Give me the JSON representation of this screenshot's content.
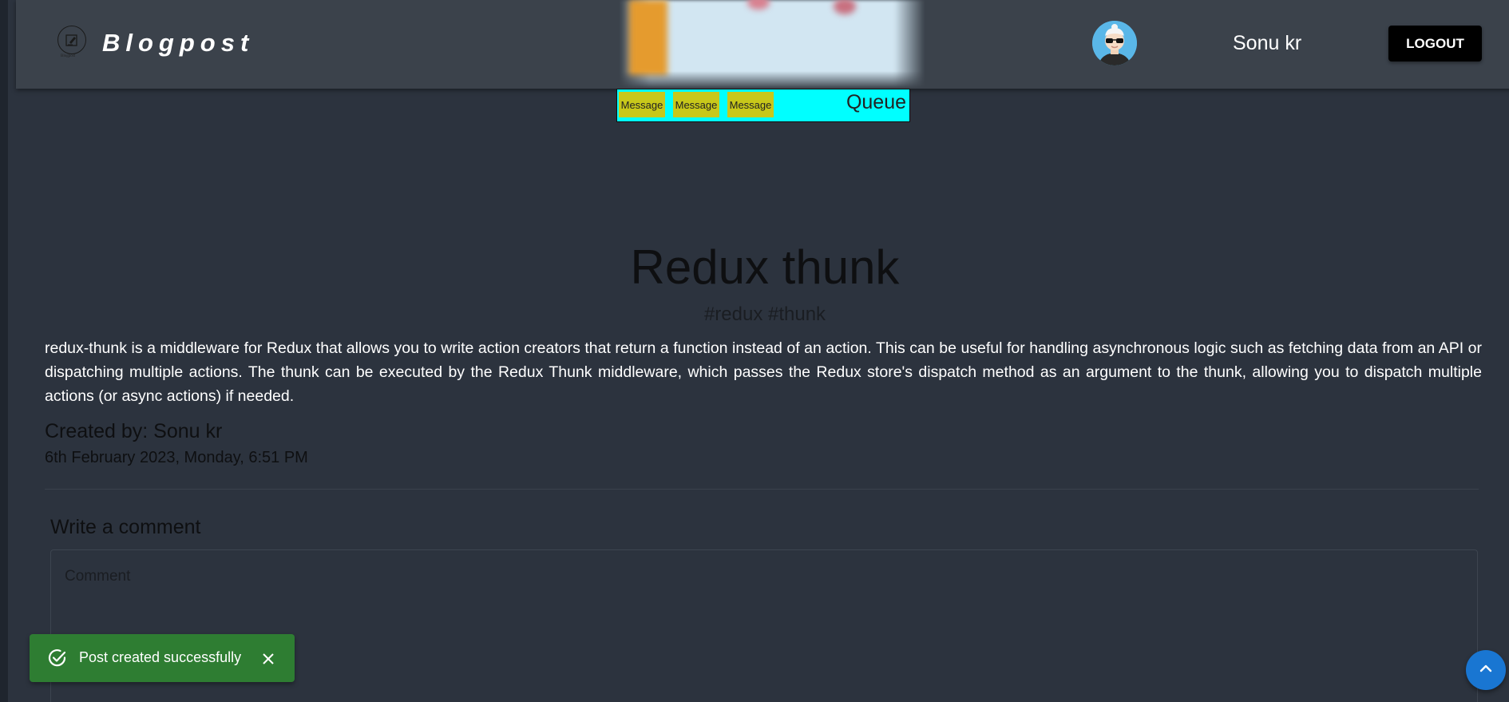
{
  "header": {
    "brand": "Blogpost",
    "logo_subtext": "Blogpost",
    "user_name": "Sonu kr",
    "logout_label": "LOGOUT"
  },
  "queue_banner": {
    "messages": [
      "Message",
      "Message",
      "Message"
    ],
    "label": "Queue"
  },
  "post": {
    "title": "Redux thunk",
    "tags": "#redux #thunk",
    "body": "redux-thunk is a middleware for Redux that allows you to write action creators that return a function instead of an action. This can be useful for handling asynchronous logic such as fetching data from an API or dispatching multiple actions. The thunk can be executed by the Redux Thunk middleware, which passes the Redux store's dispatch method as an argument to the thunk, allowing you to dispatch multiple actions (or async actions) if needed.",
    "created_by": "Created by: Sonu kr",
    "created_date": "6th February 2023, Monday, 6:51 PM"
  },
  "comments": {
    "heading": "Write a comment",
    "placeholder": "Comment"
  },
  "toast": {
    "message": "Post created successfully"
  },
  "colors": {
    "background": "#2c333e",
    "header": "#3b424b",
    "toast": "#2e7d32",
    "scroll_button": "#1976d2",
    "queue": "#00ffff",
    "message_box": "#c8c81a"
  },
  "icons": [
    "logo-icon",
    "avatar",
    "check-circle-icon",
    "close-icon",
    "chevron-up-icon"
  ]
}
